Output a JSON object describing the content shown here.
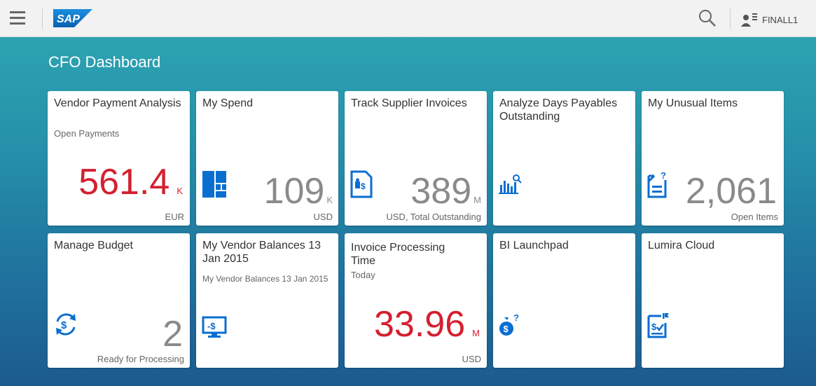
{
  "shell": {
    "user_name": "FINALL1",
    "logo_text": "SAP"
  },
  "page": {
    "title": "CFO Dashboard"
  },
  "tiles": [
    {
      "id": "vendor-payment-analysis",
      "title": "Vendor Payment Analysis",
      "subtitle": "Open Payments",
      "value": "561.4",
      "scale": "K",
      "footer": "EUR",
      "value_color": "#d32030",
      "icon": ""
    },
    {
      "id": "my-spend",
      "title": "My Spend",
      "subtitle": "",
      "value": "109",
      "scale": "K",
      "footer": "USD",
      "value_color": "#8a8a8a",
      "icon": "tiles-chart-icon"
    },
    {
      "id": "track-supplier-invoices",
      "title": "Track Supplier Invoices",
      "subtitle": "",
      "value": "389",
      "scale": "M",
      "footer": "USD, Total Outstanding",
      "value_color": "#8a8a8a",
      "icon": "supplier-invoice-icon"
    },
    {
      "id": "analyze-days-payables",
      "title": "Analyze Days Payables Outstanding",
      "subtitle": "",
      "value": "",
      "scale": "",
      "footer": "",
      "icon": "bar-chart-search-icon"
    },
    {
      "id": "my-unusual-items",
      "title": "My Unusual Items",
      "subtitle": "",
      "value": "2,061",
      "scale": "",
      "footer": "Open Items",
      "value_color": "#8a8a8a",
      "icon": "document-question-icon"
    },
    {
      "id": "manage-budget",
      "title": "Manage Budget",
      "subtitle": "",
      "value": "2",
      "scale": "",
      "footer": "Ready for Processing",
      "value_color": "#8a8a8a",
      "icon": "money-refresh-icon"
    },
    {
      "id": "my-vendor-balances",
      "title": "My Vendor Balances 13 Jan 2015",
      "subtitle": "My Vendor Balances 13 Jan 2015",
      "value": "",
      "scale": "",
      "footer": "",
      "icon": "monitor-money-icon"
    },
    {
      "id": "invoice-processing-time",
      "title": "Invoice Processing Time",
      "subtitle": "Today",
      "value": "33.96",
      "scale": "M",
      "footer": "USD",
      "value_color": "#d32030",
      "icon": ""
    },
    {
      "id": "bi-launchpad",
      "title": "BI Launchpad",
      "subtitle": "",
      "value": "",
      "scale": "",
      "footer": "",
      "icon": "money-bag-question-icon"
    },
    {
      "id": "lumira-cloud",
      "title": "Lumira Cloud",
      "subtitle": "",
      "value": "",
      "scale": "",
      "footer": "",
      "icon": "money-document-check-icon"
    }
  ],
  "colors": {
    "accent": "#0a6ed1",
    "critical": "#d32030",
    "neutral": "#8a8a8a"
  }
}
